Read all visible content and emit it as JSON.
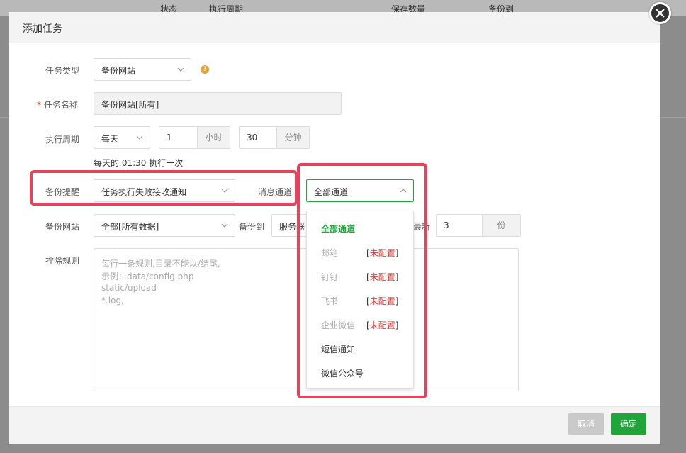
{
  "background": {
    "headers": [
      "状态",
      "执行周期",
      "保存数量",
      "备份到"
    ]
  },
  "modal": {
    "title": "添加任务",
    "fields": {
      "task_type": {
        "label": "任务类型",
        "value": "备份网站"
      },
      "task_name": {
        "label": "任务名称",
        "required_mark": "*",
        "value": "备份网站[所有]"
      },
      "cycle": {
        "label": "执行周期",
        "period": "每天",
        "hour": "1",
        "hour_unit": "小时",
        "minute": "30",
        "minute_unit": "分钟",
        "description": "每天的 01:30 执行一次"
      },
      "reminder": {
        "label": "备份提醒",
        "value": "任务执行失败接收通知"
      },
      "channel": {
        "label": "消息通道",
        "value": "全部通道"
      },
      "site": {
        "label": "备份网站",
        "value": "全部[所有数据]"
      },
      "backup_to": {
        "label": "备份到",
        "value": "服务器"
      },
      "keep": {
        "label": "最新",
        "value": "3",
        "unit": "份"
      },
      "exclude": {
        "label": "排除规则",
        "placeholder_lines": [
          "每行一条规则,目录不能以/结尾,",
          "示例：data/config.php",
          "static/upload",
          "*.log,"
        ]
      }
    },
    "dropdown": {
      "items": [
        {
          "label": "全部通道",
          "state": "active",
          "tag": ""
        },
        {
          "label": "邮箱",
          "state": "disabled",
          "tag": "未配置"
        },
        {
          "label": "钉钉",
          "state": "disabled",
          "tag": "未配置"
        },
        {
          "label": "飞书",
          "state": "disabled",
          "tag": "未配置"
        },
        {
          "label": "企业微信",
          "state": "disabled",
          "tag": "未配置"
        },
        {
          "label": "短信通知",
          "state": "normal",
          "tag": ""
        },
        {
          "label": "微信公众号",
          "state": "normal",
          "tag": ""
        }
      ]
    },
    "footer": {
      "cancel": "取消",
      "confirm": "确定"
    }
  },
  "colors": {
    "accent": "#20a53a",
    "highlight": "#e8415b",
    "warning": "#e4a236",
    "error": "#e53935"
  }
}
